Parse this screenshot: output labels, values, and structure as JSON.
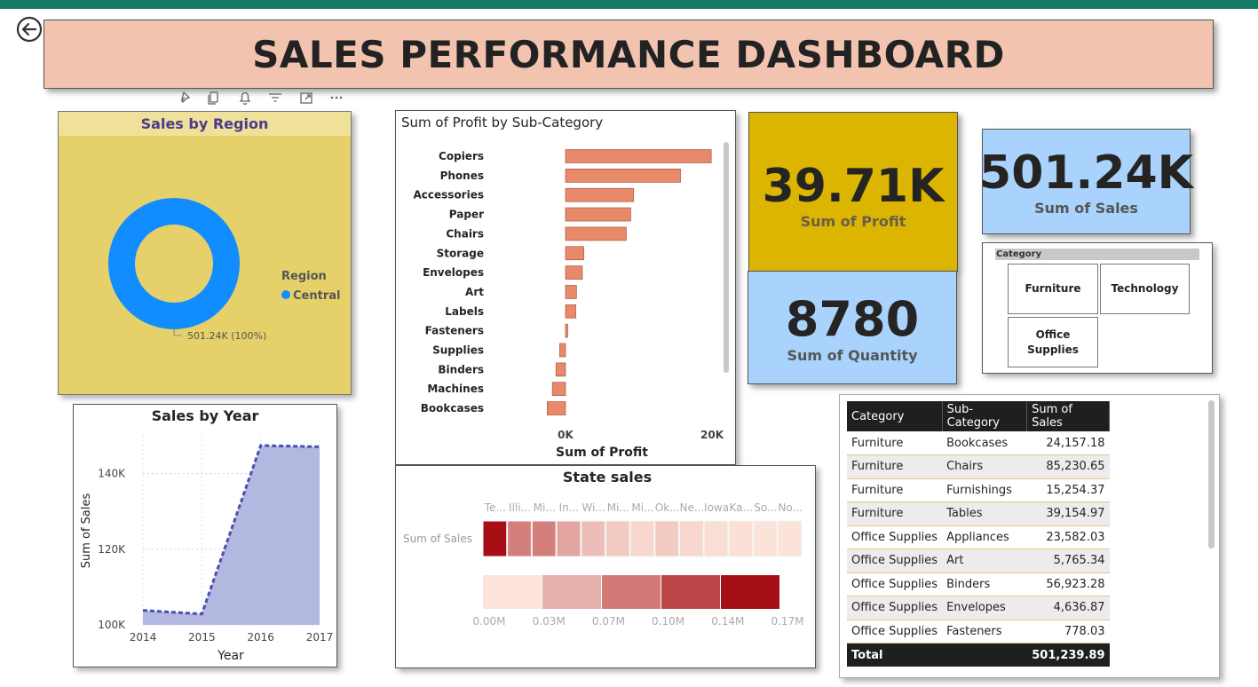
{
  "title": "SALES PERFORMANCE DASHBOARD",
  "region_chart": {
    "title": "Sales by Region",
    "legend_title": "Region",
    "chart_data": {
      "type": "pie",
      "title": "Sales by Region",
      "categories": [
        "Central"
      ],
      "values": [
        501.24
      ],
      "unit": "K",
      "data_labels": [
        "501.24K (100%)"
      ],
      "legend_title": "Region",
      "legend_placement": "right",
      "colors": [
        "#118dff"
      ]
    }
  },
  "year_chart": {
    "title": "Sales by Year",
    "xlabel": "Year",
    "ylabel": "Sum of Sales",
    "yticks": [
      "140K",
      "120K",
      "100K"
    ],
    "xticks": [
      "2014",
      "2015",
      "2016",
      "2017"
    ],
    "chart_data": {
      "type": "area",
      "title": "Sales by Year",
      "x": [
        2014,
        2015,
        2016,
        2017
      ],
      "values": [
        103838,
        102874,
        147429,
        147098
      ],
      "xlabel": "Year",
      "ylabel": "Sum of Sales",
      "ylim": [
        100000,
        150000
      ],
      "grid": true,
      "colors": [
        "#4b4fb0",
        "#b3b8e0"
      ]
    }
  },
  "profit_chart": {
    "title": "Sum of Profit by Sub-Category",
    "xlabel": "Sum of Profit",
    "xticks": [
      "0K",
      "20K"
    ],
    "chart_data": {
      "type": "bar",
      "orientation": "horizontal",
      "title": "Sum of Profit by Sub-Category",
      "categories": [
        "Copiers",
        "Phones",
        "Accessories",
        "Paper",
        "Chairs",
        "Storage",
        "Envelopes",
        "Art",
        "Labels",
        "Fasteners",
        "Supplies",
        "Binders",
        "Machines",
        "Bookcases"
      ],
      "values": [
        19900,
        15700,
        9300,
        8900,
        8300,
        2500,
        2300,
        1500,
        1400,
        300,
        -800,
        -1300,
        -1800,
        -2500
      ],
      "xlabel": "Sum of Profit",
      "xlim": [
        0,
        25000
      ],
      "colors": [
        "#e8896a"
      ]
    }
  },
  "kpis": {
    "profit": {
      "value": "39.71K",
      "label": "Sum of Profit",
      "color": "#dbb500"
    },
    "sales": {
      "value": "501.24K",
      "label": "Sum of Sales",
      "color": "#a9d3fd"
    },
    "quantity": {
      "value": "8780",
      "label": "Sum of Quantity",
      "color": "#a9d3fd"
    }
  },
  "slicer": {
    "header": "Category",
    "options": [
      "Furniture",
      "Technology",
      "Office Supplies"
    ]
  },
  "state_chart": {
    "title": "State sales",
    "row_label": "Sum of Sales",
    "column_labels": [
      "Te...",
      "Illi...",
      "Mi...",
      "In...",
      "Wi...",
      "Mi...",
      "Mi...",
      "Ok...",
      "Ne...",
      "Iowa",
      "Ka...",
      "So...",
      "No..."
    ],
    "scale_labels": [
      "0.00M",
      "0.03M",
      "0.07M",
      "0.10M",
      "0.14M",
      "0.17M"
    ],
    "chart_data": {
      "type": "heatmap",
      "title": "State sales",
      "row_label": "Sum of Sales",
      "columns": [
        "Te...",
        "Illi...",
        "Mi...",
        "In...",
        "Wi...",
        "Mi...",
        "Mi...",
        "Ok...",
        "Ne...",
        "Iowa",
        "Ka...",
        "So...",
        "No..."
      ],
      "values": [
        0.17,
        0.08,
        0.08,
        0.05,
        0.03,
        0.02,
        0.01,
        0.02,
        0.01,
        0.005,
        0.003,
        0.001,
        0.001
      ],
      "scale_min": 0,
      "scale_max": 0.17,
      "scale_unit": "M",
      "colors": [
        "#fce4da",
        "#a50f15"
      ]
    }
  },
  "table": {
    "columns": [
      "Category",
      "Sub-Category",
      "Sum of Sales"
    ],
    "rows": [
      [
        "Furniture",
        "Bookcases",
        "24,157.18"
      ],
      [
        "Furniture",
        "Chairs",
        "85,230.65"
      ],
      [
        "Furniture",
        "Furnishings",
        "15,254.37"
      ],
      [
        "Furniture",
        "Tables",
        "39,154.97"
      ],
      [
        "Office Supplies",
        "Appliances",
        "23,582.03"
      ],
      [
        "Office Supplies",
        "Art",
        "5,765.34"
      ],
      [
        "Office Supplies",
        "Binders",
        "56,923.28"
      ],
      [
        "Office Supplies",
        "Envelopes",
        "4,636.87"
      ],
      [
        "Office Supplies",
        "Fasteners",
        "778.03"
      ]
    ],
    "total": [
      "Total",
      "",
      "501,239.89"
    ]
  },
  "colors": {
    "topbar": "#137a65",
    "title_bg": "#f2c4b0",
    "region_bg": "#e6d06a",
    "donut": "#118dff"
  }
}
